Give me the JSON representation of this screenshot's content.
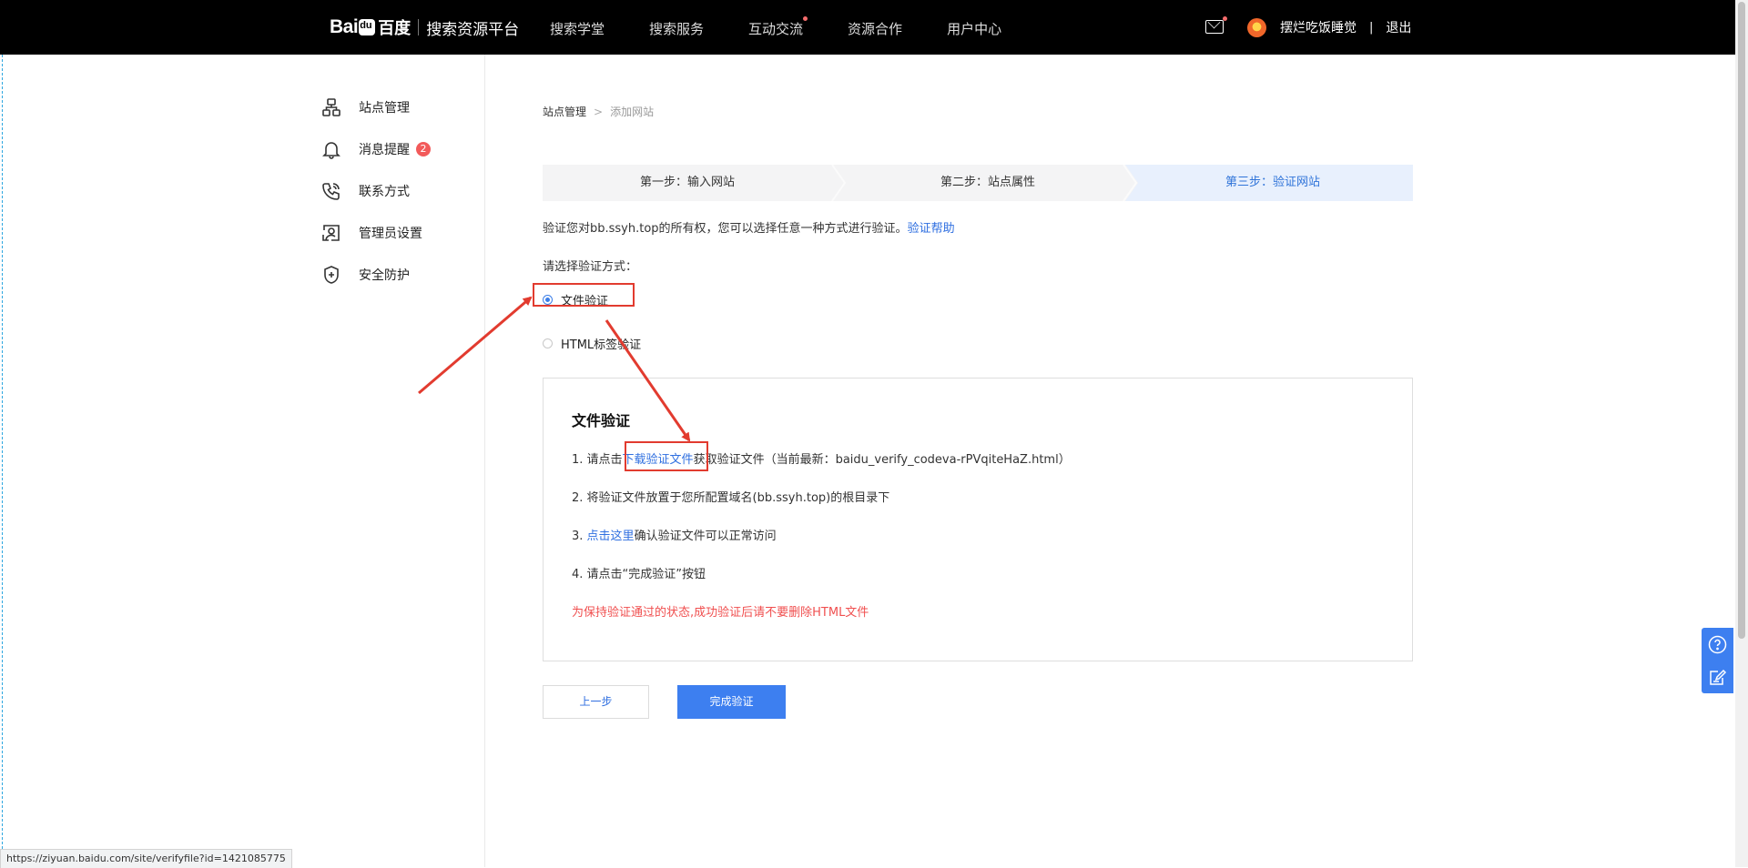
{
  "header": {
    "logo_bai": "Bai",
    "logo_cn": "百度",
    "logo_sub": "搜索资源平台",
    "nav": [
      {
        "label": "搜索学堂",
        "dot": false
      },
      {
        "label": "搜索服务",
        "dot": false
      },
      {
        "label": "互动交流",
        "dot": true
      },
      {
        "label": "资源合作",
        "dot": false
      },
      {
        "label": "用户中心",
        "dot": false
      }
    ],
    "username": "摆烂吃饭睡觉",
    "separator": "|",
    "logout": "退出"
  },
  "sidebar": {
    "items": [
      {
        "label": "站点管理",
        "icon": "sitemap-icon"
      },
      {
        "label": "消息提醒",
        "icon": "bell-icon",
        "badge": "2"
      },
      {
        "label": "联系方式",
        "icon": "phone-icon"
      },
      {
        "label": "管理员设置",
        "icon": "admin-icon"
      },
      {
        "label": "安全防护",
        "icon": "shield-icon"
      }
    ]
  },
  "breadcrumb": {
    "root": "站点管理",
    "arrow": ">",
    "current": "添加网站"
  },
  "steps": [
    {
      "label": "第一步：输入网站",
      "active": false
    },
    {
      "label": "第二步：站点属性",
      "active": false
    },
    {
      "label": "第三步：验证网站",
      "active": true
    }
  ],
  "description": {
    "text": "验证您对bb.ssyh.top的所有权，您可以选择任意一种方式进行验证。",
    "help_link": "验证帮助"
  },
  "verify_choice": {
    "label": "请选择验证方式：",
    "options": [
      {
        "label": "文件验证",
        "selected": true
      },
      {
        "label": "HTML标签验证",
        "selected": false
      }
    ]
  },
  "file_panel": {
    "title": "文件验证",
    "step1_prefix": "1.  请点击",
    "step1_link": "下载验证文件",
    "step1_suffix": "获取验证文件（当前最新：baidu_verify_codeva-rPVqiteHaZ.html）",
    "step2": "2.  将验证文件放置于您所配置域名(bb.ssyh.top)的根目录下",
    "step3_prefix": "3.  ",
    "step3_link": "点击这里",
    "step3_suffix": "确认验证文件可以正常访问",
    "step4": "4.  请点击“完成验证”按钮",
    "warning": "为保持验证通过的状态,成功验证后请不要删除HTML文件"
  },
  "buttons": {
    "prev": "上一步",
    "done": "完成验证"
  },
  "status_url": "https://ziyuan.baidu.com/site/verifyfile?id=1421085775",
  "colors": {
    "accent": "#3d7ff0",
    "annotation": "#e23b2f",
    "warning": "#f04f4f"
  }
}
